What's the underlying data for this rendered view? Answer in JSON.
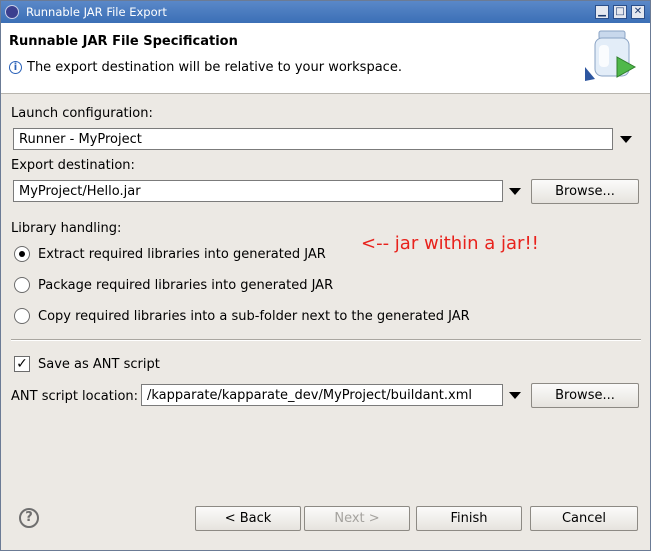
{
  "window": {
    "title": "Runnable JAR File Export"
  },
  "header": {
    "title": "Runnable JAR File Specification",
    "message": "The export destination will be relative to your workspace."
  },
  "launch": {
    "label": "Launch configuration:",
    "value": "Runner - MyProject"
  },
  "export": {
    "label": "Export destination:",
    "value": "MyProject/Hello.jar",
    "browse": "Browse..."
  },
  "library": {
    "label": "Library handling:",
    "options": [
      {
        "label": "Extract required libraries into generated JAR",
        "selected": true
      },
      {
        "label": "Package required libraries into generated JAR",
        "selected": false
      },
      {
        "label": "Copy required libraries into a sub-folder next to the generated JAR",
        "selected": false
      }
    ]
  },
  "annotation": "<-- jar within a jar!!",
  "ant": {
    "checkbox_label": "Save as ANT script",
    "checked": true,
    "location_label": "ANT script location:",
    "location_value": "/kapparate/kapparate_dev/MyProject/buildant.xml",
    "browse": "Browse..."
  },
  "footer": {
    "back": "< Back",
    "next": "Next >",
    "finish": "Finish",
    "cancel": "Cancel"
  },
  "colors": {
    "annotation": "#e8221c",
    "titlebar": "#4a7bc0"
  }
}
